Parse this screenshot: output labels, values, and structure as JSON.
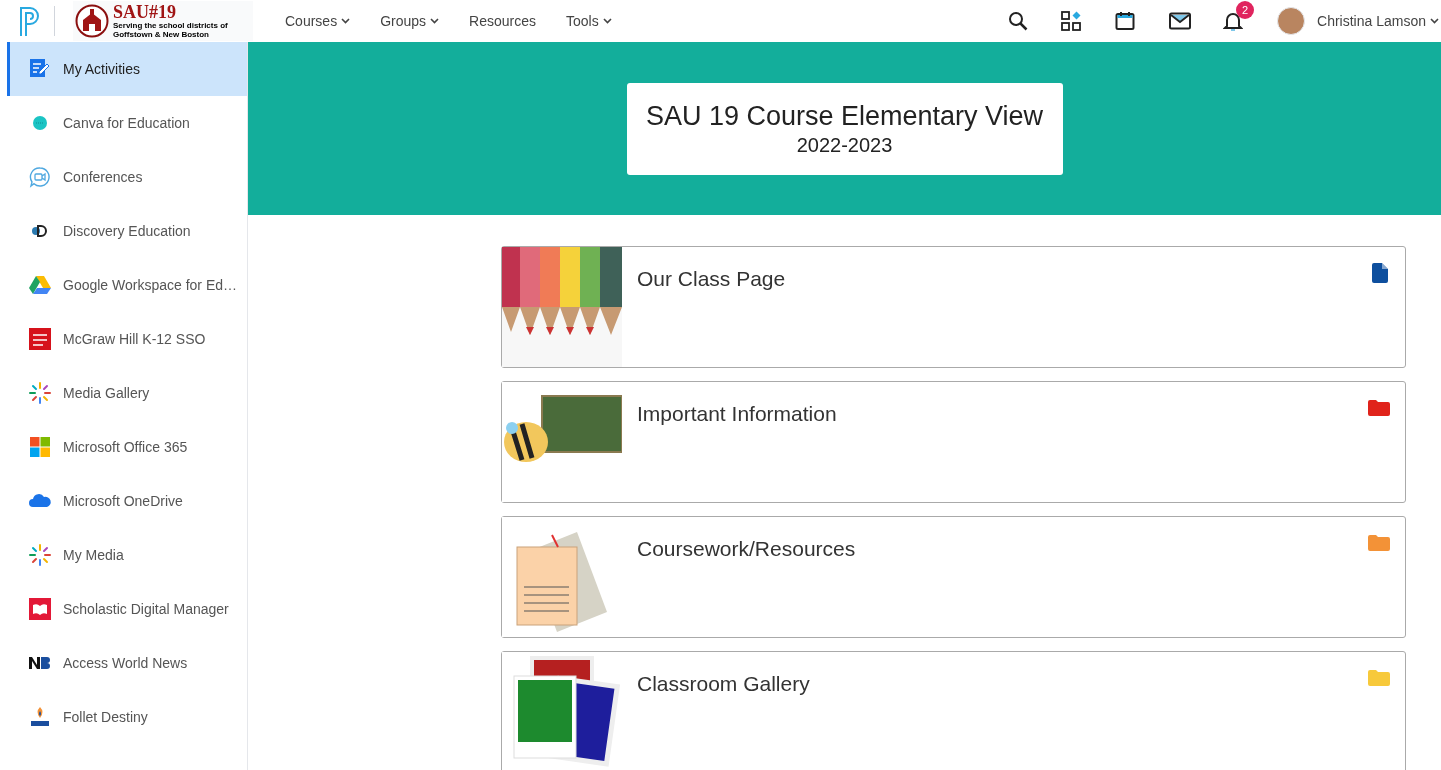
{
  "header": {
    "logo_title": "SAU#19",
    "logo_subtitle": "Serving the school districts of Goffstown & New Boston",
    "nav": [
      {
        "label": "Courses",
        "dropdown": true
      },
      {
        "label": "Groups",
        "dropdown": true
      },
      {
        "label": "Resources",
        "dropdown": false
      },
      {
        "label": "Tools",
        "dropdown": true
      }
    ],
    "notification_count": "2",
    "user_name": "Christina Lamson"
  },
  "sidebar": {
    "items": [
      {
        "label": "My Activities",
        "selected": true
      },
      {
        "label": "Canva for Education",
        "selected": false
      },
      {
        "label": "Conferences",
        "selected": false
      },
      {
        "label": "Discovery Education",
        "selected": false
      },
      {
        "label": "Google Workspace for Ed…",
        "selected": false
      },
      {
        "label": "McGraw Hill K-12 SSO",
        "selected": false
      },
      {
        "label": "Media Gallery",
        "selected": false
      },
      {
        "label": "Microsoft Office 365",
        "selected": false
      },
      {
        "label": "Microsoft OneDrive",
        "selected": false
      },
      {
        "label": "My Media",
        "selected": false
      },
      {
        "label": "Scholastic Digital Manager",
        "selected": false
      },
      {
        "label": "Access World News",
        "selected": false
      },
      {
        "label": "Follet Destiny",
        "selected": false
      }
    ]
  },
  "banner": {
    "title": "SAU 19 Course Elementary View",
    "subtitle": "2022-2023"
  },
  "items": [
    {
      "title": "Our Class Page",
      "kind": "page",
      "color": "#0e4f9e"
    },
    {
      "title": "Important Information",
      "kind": "folder",
      "color": "#e0231b"
    },
    {
      "title": "Coursework/Resources",
      "kind": "folder",
      "color": "#f39237"
    },
    {
      "title": "Classroom Gallery",
      "kind": "folder",
      "color": "#f7c93b"
    }
  ]
}
